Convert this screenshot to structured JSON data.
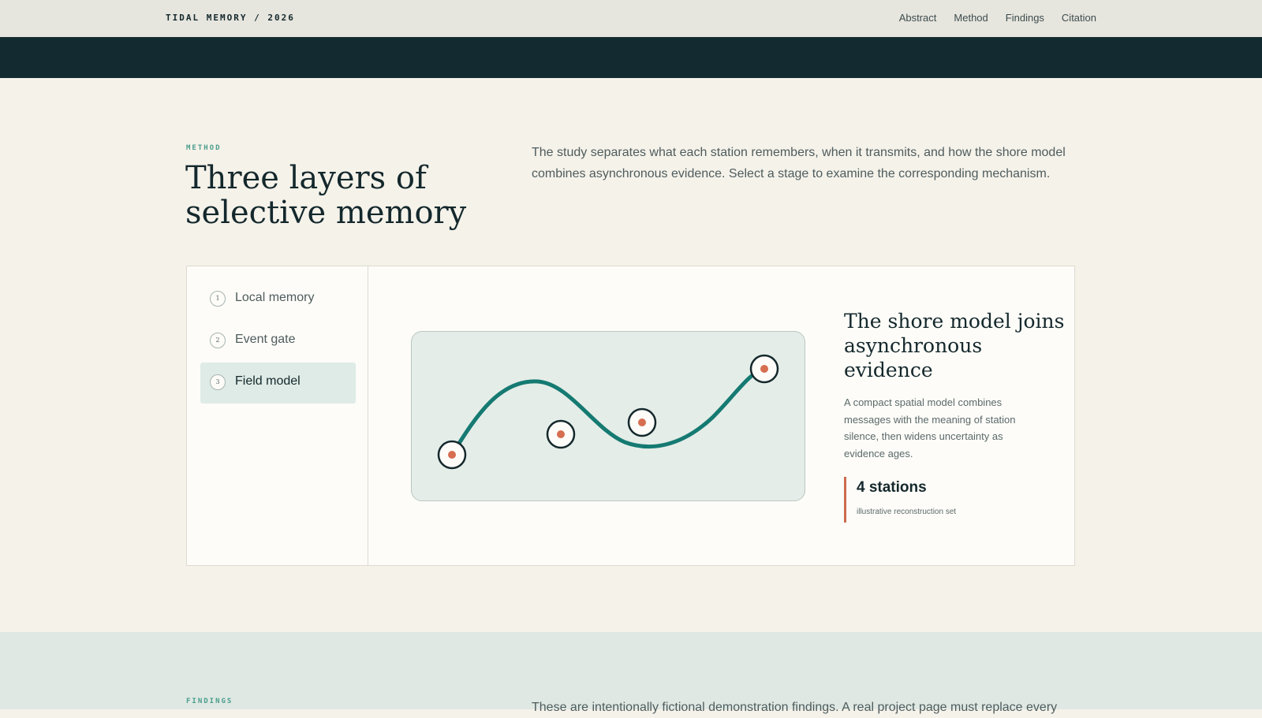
{
  "header": {
    "brand": "TIDAL MEMORY / 2026",
    "nav": [
      "Abstract",
      "Method",
      "Findings",
      "Citation"
    ]
  },
  "method": {
    "eyebrow": "METHOD",
    "title": "Three layers of selective memory",
    "description": "The study separates what each station remembers, when it transmits, and how the shore model combines asynchronous evidence. Select a stage to examine the corresponding mechanism.",
    "stages": [
      {
        "num": "1",
        "label": "Local memory",
        "active": false
      },
      {
        "num": "2",
        "label": "Event gate",
        "active": false
      },
      {
        "num": "3",
        "label": "Field model",
        "active": true
      }
    ],
    "detail": {
      "title": "The shore model joins asynchronous evidence",
      "description": "A compact spatial model combines messages with the meaning of station silence, then widens uncertainty as evidence ages.",
      "stat_value": "4 stations",
      "stat_caption": "illustrative reconstruction set"
    }
  },
  "findings": {
    "eyebrow": "FINDINGS",
    "description": "These are intentionally fictional demonstration findings. A real project page must replace every"
  },
  "colors": {
    "accent": "#157a72",
    "marker": "#d66e50",
    "dark": "#132a30"
  }
}
